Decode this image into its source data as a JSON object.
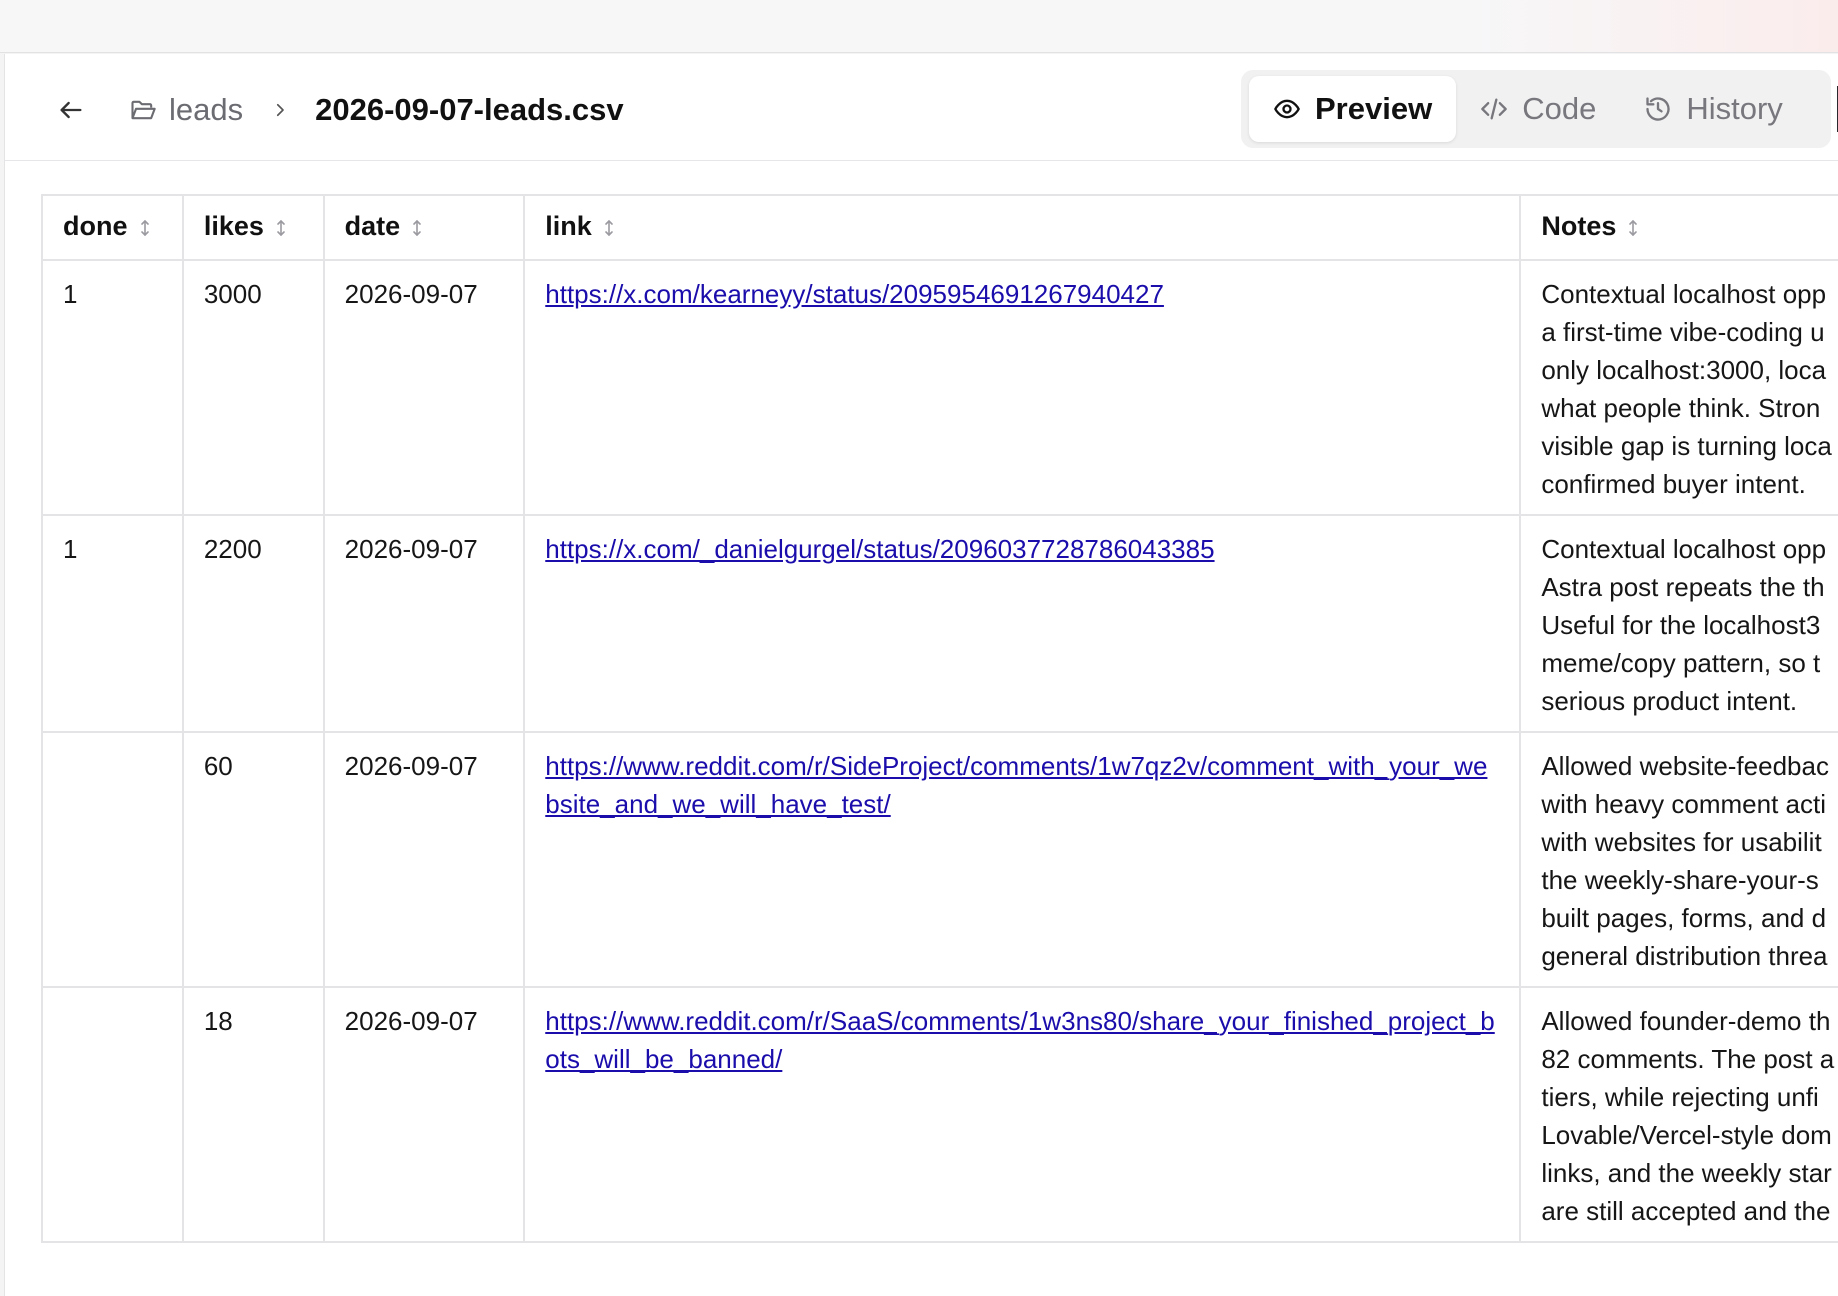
{
  "breadcrumb": {
    "folder": "leads",
    "file": "2026-09-07-leads.csv"
  },
  "view_tabs": [
    {
      "label": "Preview",
      "icon": "eye-icon",
      "active": true
    },
    {
      "label": "Code",
      "icon": "code-icon",
      "active": false
    },
    {
      "label": "History",
      "icon": "history-icon",
      "active": false
    }
  ],
  "table": {
    "columns": [
      "done",
      "likes",
      "date",
      "link",
      "Notes"
    ],
    "rows": [
      {
        "done": "1",
        "likes": "3000",
        "date": "2026-09-07",
        "link": "https://x.com/kearneyy/status/2095954691267940427",
        "notes": [
          "Contextual localhost opp",
          "a first-time vibe-coding u",
          "only localhost:3000, loca",
          "what people think. Stron",
          "visible gap is turning loca",
          "confirmed buyer intent."
        ]
      },
      {
        "done": "1",
        "likes": "2200",
        "date": "2026-09-07",
        "link": "https://x.com/_danielgurgel/status/2096037728786043385",
        "notes": [
          "Contextual localhost opp",
          "Astra post repeats the th",
          "Useful for the localhost3",
          "meme/copy pattern, so t",
          "serious product intent."
        ]
      },
      {
        "done": "",
        "likes": "60",
        "date": "2026-09-07",
        "link": "https://www.reddit.com/r/SideProject/comments/1w7qz2v/comment_with_your_website_and_we_will_have_test/",
        "notes": [
          "Allowed website-feedbac",
          "with heavy comment acti",
          "with websites for usabilit",
          "the weekly-share-your-s",
          "built pages, forms, and d",
          "general distribution threa"
        ]
      },
      {
        "done": "",
        "likes": "18",
        "date": "2026-09-07",
        "link": "https://www.reddit.com/r/SaaS/comments/1w3ns80/share_your_finished_project_bots_will_be_banned/",
        "notes": [
          "Allowed founder-demo th",
          "82 comments. The post a",
          "tiers, while rejecting unfi",
          "Lovable/Vercel-style dom",
          "links, and the weekly star",
          "are still accepted and the"
        ]
      }
    ]
  },
  "colors": {
    "link": "#1a0dab",
    "border": "#e4e4e7",
    "tab_bg": "#f1f1f2"
  }
}
